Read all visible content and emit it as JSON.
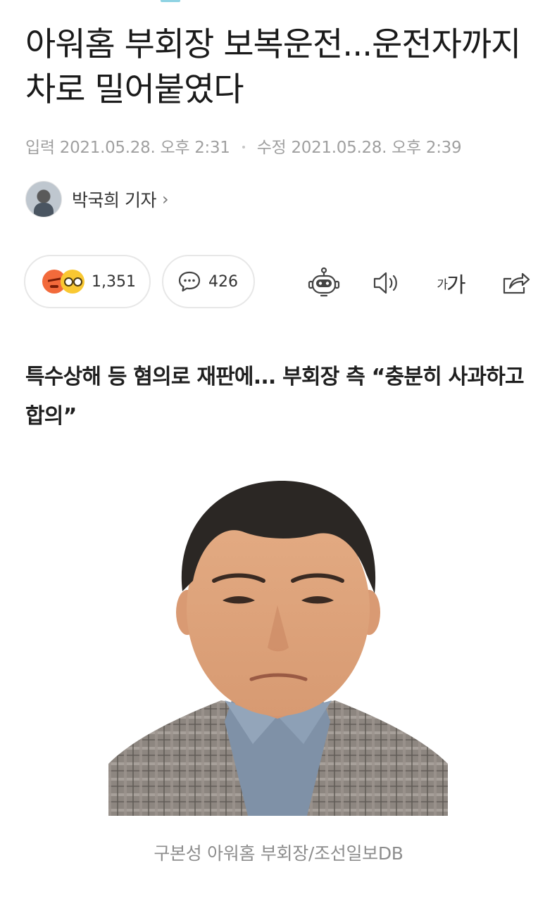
{
  "article": {
    "headline": "아워홈 부회장 보복운전...운전자까지 차로 밀어붙였다",
    "meta": {
      "input_label": "입력",
      "input_time": "2021.05.28. 오후 2:31",
      "modified_label": "수정",
      "modified_time": "2021.05.28. 오후 2:39"
    },
    "author": {
      "name": "박국희 기자",
      "chevron": "›"
    },
    "reactions": {
      "count": "1,351",
      "icons": [
        "angry-emoji-icon",
        "shocked-emoji-icon"
      ]
    },
    "comments": {
      "count": "426",
      "icon": "speech-bubble-icon"
    },
    "toolbar": {
      "font_size_small": "가",
      "font_size_large": "가",
      "icons": [
        "robot-summary-icon",
        "speaker-icon",
        "font-size-icon",
        "share-icon"
      ]
    },
    "subheading": "특수상해 등 혐의로 재판에... 부회장 측 “충분히 사과하고 합의”",
    "photo": {
      "caption": "구본성 아워홈 부회장/조선일보DB"
    }
  },
  "colors": {
    "text": "#1a1a1a",
    "meta": "#a0a0a0",
    "border": "#e7e7e7",
    "accent_tab": "#8fd3e3",
    "angry": "#f26a3b",
    "shock": "#f9c832"
  }
}
